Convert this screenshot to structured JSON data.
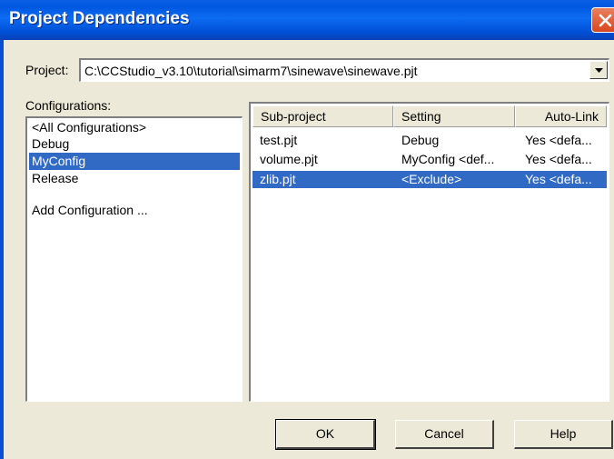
{
  "window": {
    "title": "Project Dependencies"
  },
  "project": {
    "label": "Project:",
    "value": "C:\\CCStudio_v3.10\\tutorial\\simarm7\\sinewave\\sinewave.pjt"
  },
  "configurations": {
    "label": "Configurations:",
    "items": [
      {
        "label": "<All Configurations>",
        "selected": false
      },
      {
        "label": "Debug",
        "selected": false
      },
      {
        "label": "MyConfig",
        "selected": true
      },
      {
        "label": "Release",
        "selected": false
      },
      {
        "label": "",
        "selected": false
      },
      {
        "label": "Add Configuration ...",
        "selected": false
      }
    ]
  },
  "dependencies": {
    "columns": [
      "Sub-project",
      "Setting",
      "Auto-Link"
    ],
    "rows": [
      {
        "subproject": "test.pjt",
        "setting": "Debug",
        "autolink": "Yes <defa...",
        "selected": false
      },
      {
        "subproject": "volume.pjt",
        "setting": "MyConfig  <def...",
        "autolink": "Yes <defa...",
        "selected": false
      },
      {
        "subproject": "zlib.pjt",
        "setting": "<Exclude>",
        "autolink": "Yes <defa...",
        "selected": true
      }
    ]
  },
  "buttons": {
    "ok": "OK",
    "cancel": "Cancel",
    "help": "Help"
  },
  "colors": {
    "titlebar": "#0058e0",
    "selection": "#316ac5",
    "dialog_bg": "#ece9d8",
    "close": "#d8461f"
  },
  "icons": {
    "close": "close-icon",
    "dropdown": "chevron-down-icon"
  }
}
